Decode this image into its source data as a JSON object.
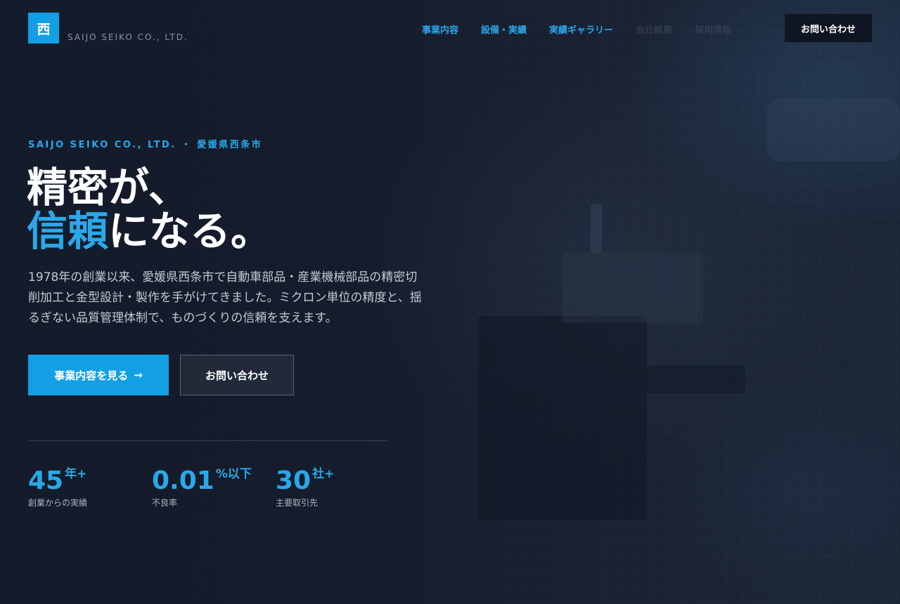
{
  "brand": {
    "logo_char": "西",
    "company_name": "SAIJO SEIKO CO., LTD."
  },
  "nav": {
    "items": [
      {
        "label": "事業内容"
      },
      {
        "label": "設備・実績"
      },
      {
        "label": "実績ギャラリー"
      },
      {
        "label": "会社概要"
      },
      {
        "label": "採用情報"
      }
    ],
    "contact_label": "お問い合わせ"
  },
  "hero": {
    "eyebrow": "SAIJO SEIKO CO., LTD. ・ 愛媛県西条市",
    "headline_line1": "精密が、",
    "headline_accent": "信頼",
    "headline_line2_rest": "になる。",
    "lead": "1978年の創業以来、愛媛県西条市で自動車部品・産業機械部品の精密切削加工と金型設計・製作を手がけてきました。ミクロン単位の精度と、揺るぎない品質管理体制で、ものづくりの信頼を支えます。",
    "primary_cta": "事業内容を見る",
    "primary_cta_arrow": "→",
    "secondary_cta": "お問い合わせ"
  },
  "stats": [
    {
      "value": "45",
      "unit": "年+",
      "label": "創業からの実績"
    },
    {
      "value": "0.01",
      "unit": "%以下",
      "label": "不良率"
    },
    {
      "value": "30",
      "unit": "社+",
      "label": "主要取引先"
    }
  ],
  "colors": {
    "accent": "#139fe3",
    "background": "#141c2c"
  }
}
